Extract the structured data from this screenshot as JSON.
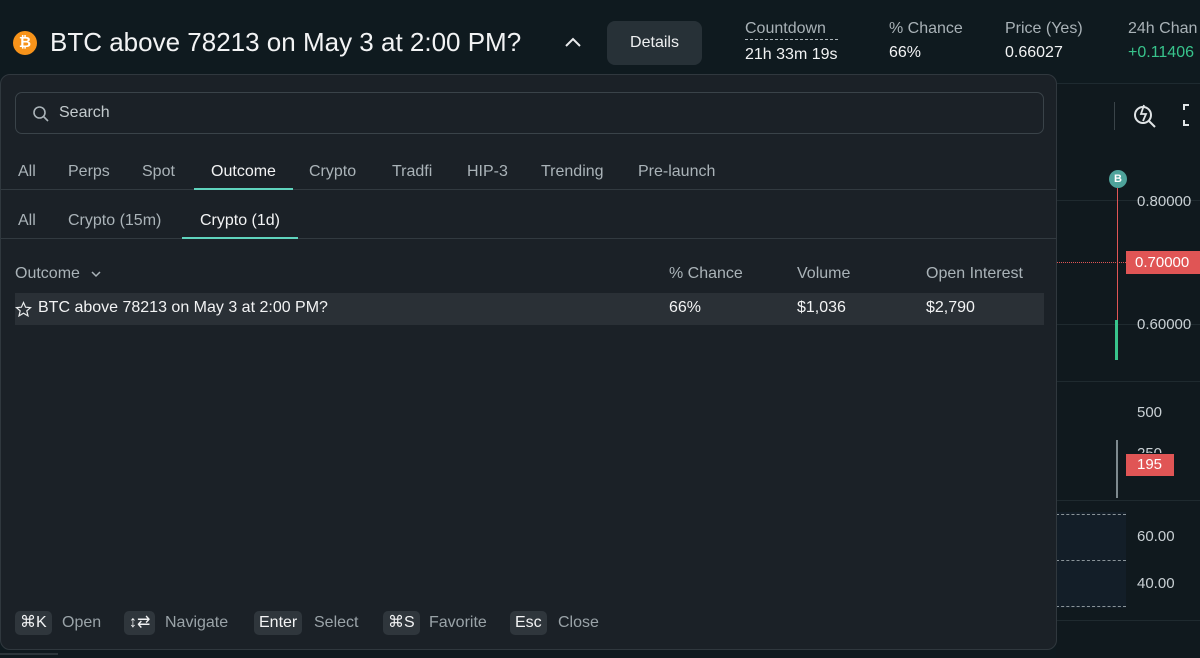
{
  "header": {
    "logo_glyph": "₿",
    "title": "BTC above 78213 on May 3 at 2:00 PM?",
    "details_label": "Details",
    "stats": [
      {
        "label": "Countdown",
        "value": "21h 33m 19s"
      },
      {
        "label": "% Chance",
        "value": "66%"
      },
      {
        "label": "Price (Yes)",
        "value": "0.66027"
      },
      {
        "label": "24h Chan",
        "value": "+0.11406"
      }
    ]
  },
  "search": {
    "placeholder": "Search",
    "value": ""
  },
  "tabs": [
    "All",
    "Perps",
    "Spot",
    "Outcome",
    "Crypto",
    "Tradfi",
    "HIP-3",
    "Trending",
    "Pre-launch"
  ],
  "active_tab": "Outcome",
  "subtabs": [
    "All",
    "Crypto (15m)",
    "Crypto (1d)"
  ],
  "active_subtab": "Crypto (1d)",
  "table": {
    "columns": [
      "Outcome",
      "% Chance",
      "Volume",
      "Open Interest"
    ],
    "rows": [
      {
        "outcome": "BTC above 78213 on May 3 at 2:00 PM?",
        "chance": "66%",
        "volume": "$1,036",
        "open_interest": "$2,790"
      }
    ]
  },
  "footer": [
    {
      "key": "⌘K",
      "action": "Open"
    },
    {
      "key": "↕⇄",
      "action": "Navigate"
    },
    {
      "key": "Enter",
      "action": "Select"
    },
    {
      "key": "⌘S",
      "action": "Favorite"
    },
    {
      "key": "Esc",
      "action": "Close"
    }
  ],
  "chart": {
    "price_axis": [
      "0.80000",
      "0.60000"
    ],
    "price_tag": "0.70000",
    "volume_axis": [
      "500",
      "250"
    ],
    "volume_tag": "195",
    "indicator_axis": [
      "60.00",
      "40.00"
    ],
    "marker": "B"
  },
  "colors": {
    "accent": "#5fd3bd",
    "positive": "#38c48c",
    "negative": "#e05555",
    "btc": "#f7931a"
  }
}
